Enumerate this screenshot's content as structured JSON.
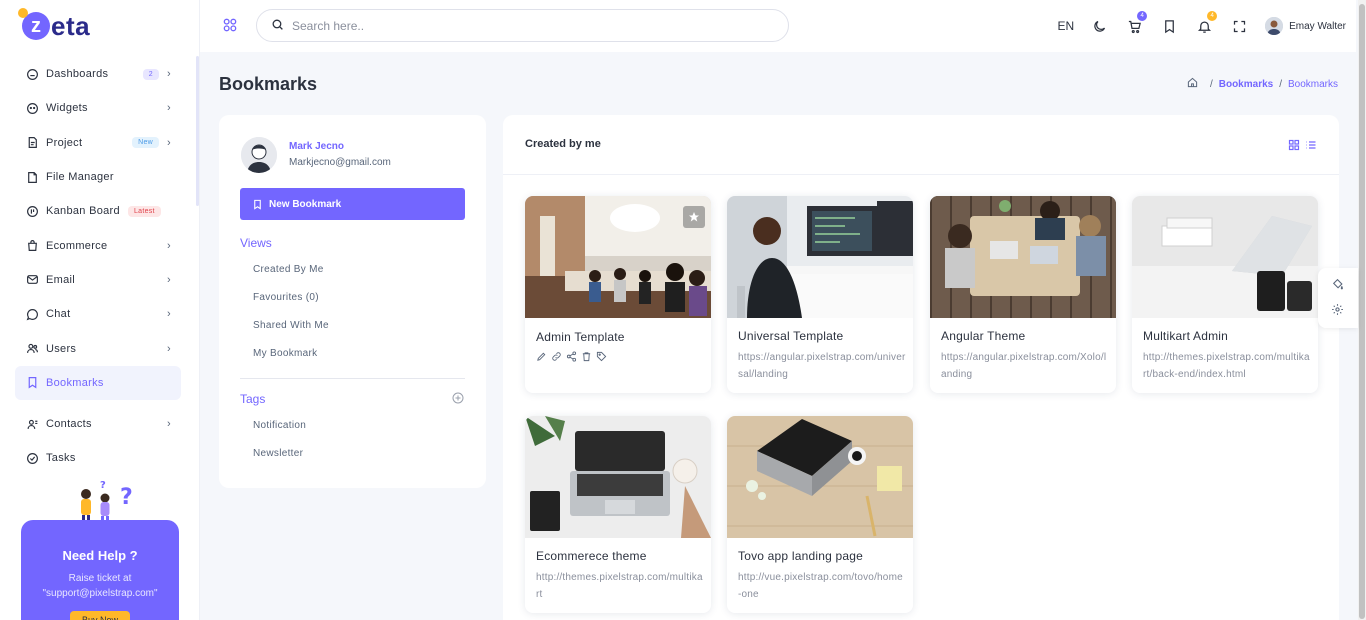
{
  "app": {
    "logo_initial": "z",
    "logo_rest": "eta"
  },
  "sidebar": {
    "items": [
      {
        "label": "Dashboards",
        "badge": "2",
        "badge_type": "count",
        "chevron": true,
        "icon": "home-icon"
      },
      {
        "label": "Widgets",
        "badge": "",
        "badge_type": "",
        "chevron": true,
        "icon": "widget-icon"
      },
      {
        "label": "Project",
        "badge": "New",
        "badge_type": "new",
        "chevron": true,
        "icon": "project-icon"
      },
      {
        "label": "File Manager",
        "badge": "",
        "badge_type": "",
        "chevron": false,
        "icon": "file-icon"
      },
      {
        "label": "Kanban Board",
        "badge": "Latest",
        "badge_type": "latest",
        "chevron": false,
        "icon": "kanban-icon"
      },
      {
        "label": "Ecommerce",
        "badge": "",
        "badge_type": "",
        "chevron": true,
        "icon": "bag-icon"
      },
      {
        "label": "Email",
        "badge": "",
        "badge_type": "",
        "chevron": true,
        "icon": "mail-icon"
      },
      {
        "label": "Chat",
        "badge": "",
        "badge_type": "",
        "chevron": true,
        "icon": "chat-icon"
      },
      {
        "label": "Users",
        "badge": "",
        "badge_type": "",
        "chevron": true,
        "icon": "users-icon"
      },
      {
        "label": "Bookmarks",
        "badge": "",
        "badge_type": "",
        "chevron": false,
        "icon": "bookmark-icon",
        "active": true
      },
      {
        "label": "Contacts",
        "badge": "",
        "badge_type": "",
        "chevron": true,
        "icon": "contacts-icon"
      },
      {
        "label": "Tasks",
        "badge": "",
        "badge_type": "",
        "chevron": false,
        "icon": "tasks-icon"
      }
    ],
    "help": {
      "title": "Need Help ?",
      "text_line1": "Raise ticket at",
      "text_line2": "\"support@pixelstrap.com\"",
      "button": "Buy Now"
    }
  },
  "header": {
    "search_placeholder": "Search here..",
    "language": "EN",
    "cart_count": "4",
    "notification_count": "4",
    "user_name": "Emay Walter"
  },
  "page": {
    "title": "Bookmarks",
    "breadcrumb": [
      "Bookmarks",
      "Bookmarks"
    ]
  },
  "profile": {
    "name": "Mark Jecno",
    "email": "Markjecno@gmail.com",
    "new_bookmark_label": "New Bookmark"
  },
  "views": {
    "title": "Views",
    "items": [
      "Created By Me",
      "Favourites (0)",
      "Shared With Me",
      "My Bookmark"
    ]
  },
  "tags": {
    "title": "Tags",
    "items": [
      "Notification",
      "Newsletter"
    ]
  },
  "main": {
    "title": "Created by me",
    "bookmarks": [
      {
        "title": "Admin Template",
        "link": "",
        "has_actions": true,
        "starred": true
      },
      {
        "title": "Universal Template",
        "link": "https://angular.pixelstrap.com/universal/landing"
      },
      {
        "title": "Angular Theme",
        "link": "https://angular.pixelstrap.com/Xolo/landing"
      },
      {
        "title": "Multikart Admin",
        "link": "http://themes.pixelstrap.com/multikart/back-end/index.html"
      },
      {
        "title": "Ecommerece theme",
        "link": "http://themes.pixelstrap.com/multikart"
      },
      {
        "title": "Tovo app landing page",
        "link": "http://vue.pixelstrap.com/tovo/home-one"
      }
    ]
  },
  "colors": {
    "accent": "#7366ff",
    "warning": "#ffb829",
    "text": "#2c323f",
    "muted": "#59667a"
  }
}
